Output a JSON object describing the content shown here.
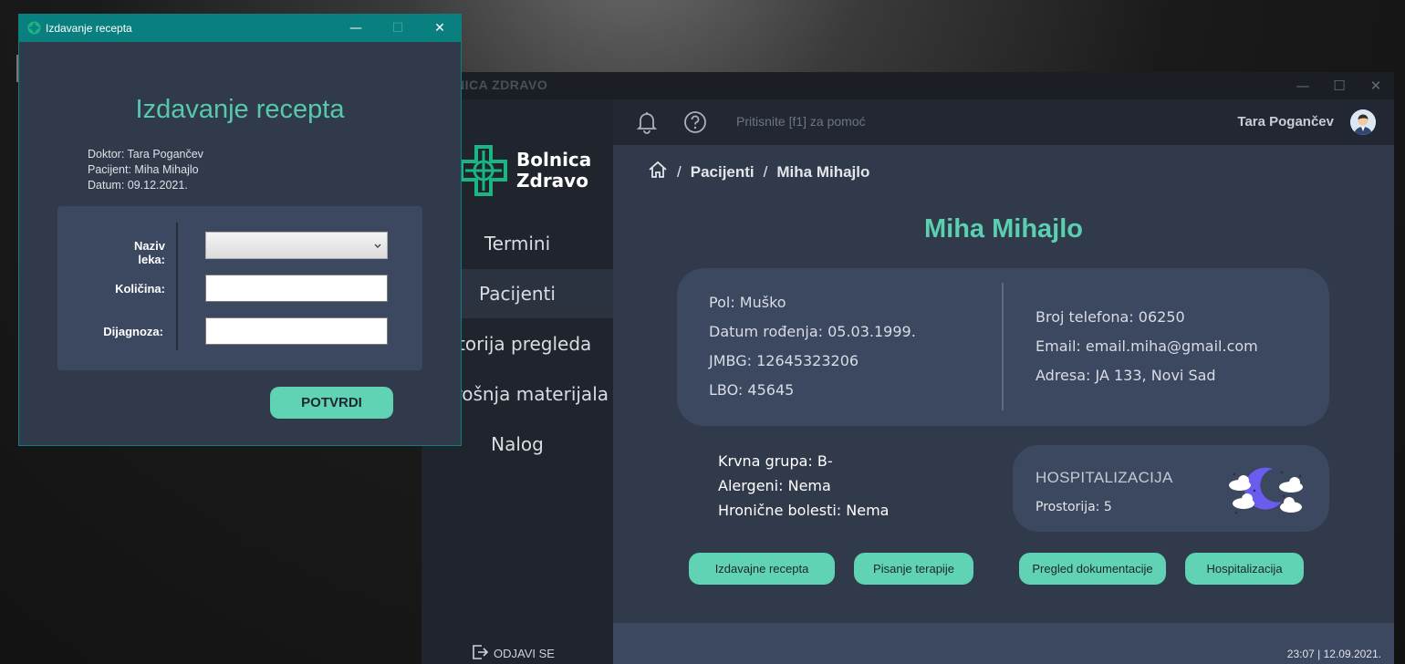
{
  "main_window": {
    "title": "BOLNICA ZDRAVO",
    "controls": {
      "minimize": "—",
      "maximize": "☐",
      "close": "✕"
    },
    "logo": {
      "line1": "Bolnica",
      "line2": "Zdravo"
    },
    "nav": [
      {
        "label": "Termini"
      },
      {
        "label": "Pacijenti"
      },
      {
        "label": "Istorija pregleda"
      },
      {
        "label": "Potrošnja materijala"
      },
      {
        "label": "Nalog"
      }
    ],
    "logout_label": "ODJAVI SE",
    "topbar": {
      "help_hint": "Pritisnite [f1] za pomoć",
      "user_name": "Tara Pogančev"
    },
    "breadcrumb": {
      "section": "Pacijenti",
      "current": "Miha Mihajlo",
      "separator": "/"
    },
    "patient_name": "Miha Mihajlo",
    "info_left": [
      "Pol: Muško",
      "Datum rođenja: 05.03.1999.",
      "JMBG: 12645323206",
      "LBO: 45645"
    ],
    "info_right": [
      "Broj telefona: 06250",
      "Email: email.miha@gmail.com",
      "Adresa: JA 133, Novi Sad"
    ],
    "medical": [
      "Krvna grupa: B-",
      "Alergeni: Nema",
      "Hronične bolesti: Nema"
    ],
    "hospitalization": {
      "title": "HOSPITALIZACIJA",
      "room": "Prostorija: 5"
    },
    "actions": [
      {
        "label": "Izdavajne recepta"
      },
      {
        "label": "Pisanje terapije"
      },
      {
        "label": "Pregled dokumentacije"
      },
      {
        "label": "Hospitalizacija"
      }
    ],
    "clock": "23:07 | 12.09.2021."
  },
  "dialog": {
    "title": "Izdavanje recepta",
    "controls": {
      "minimize": "—",
      "maximize": "☐",
      "close": "✕"
    },
    "heading": "Izdavanje recepta",
    "meta": [
      "Doktor: Tara Pogančev",
      "Pacijent: Miha Mihajlo",
      "Datum: 09.12.2021."
    ],
    "form": {
      "drug_label": "Naziv leka:",
      "drug_value": "",
      "quantity_label": "Količina:",
      "quantity_value": "",
      "diagnosis_label": "Dijagnoza:",
      "diagnosis_value": ""
    },
    "confirm_label": "POTVRDI"
  },
  "colors": {
    "accent": "#5ad0b0",
    "button": "#5fd3b4",
    "dialog_titlebar": "#0a7f80",
    "panel": "#3c4760",
    "content_bg": "#313a4b",
    "sidebar_bg": "#1f242d"
  },
  "icons": [
    "bell-icon",
    "help-icon",
    "home-icon",
    "logout-icon",
    "moon-clouds-icon",
    "hospital-cross-logo",
    "chevron-down-icon"
  ]
}
